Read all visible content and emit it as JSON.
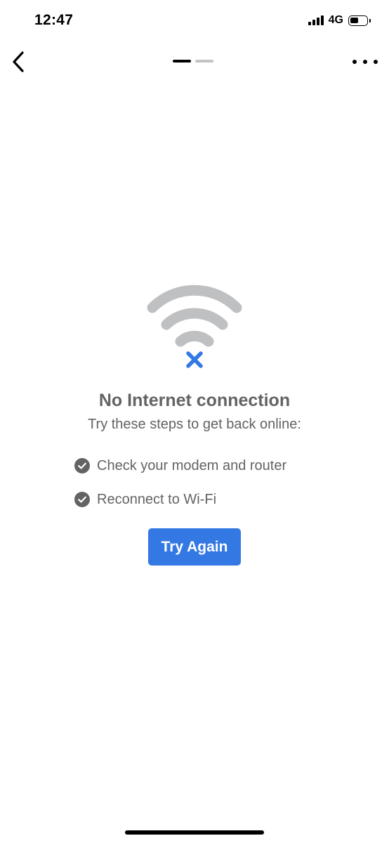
{
  "status_bar": {
    "time": "12:47",
    "network": "4G",
    "icons": [
      "signal-icon",
      "battery-icon"
    ]
  },
  "nav": {
    "back_icon": "chevron-left-icon",
    "more_icon": "more-horizontal-icon",
    "page_indicator": {
      "total": 2,
      "active_index": 0
    }
  },
  "error": {
    "icon": "wifi-off-icon",
    "title": "No Internet connection",
    "subtitle": "Try these steps to get back online:",
    "steps": [
      {
        "icon": "check-circle-icon",
        "label": "Check your modem and router"
      },
      {
        "icon": "check-circle-icon",
        "label": "Reconnect to Wi-Fi"
      }
    ],
    "retry_label": "Try Again"
  },
  "colors": {
    "accent": "#3478e4",
    "text_muted": "#636366",
    "wifi_gray": "#bfc0c2",
    "x_mark": "#3478e4"
  }
}
